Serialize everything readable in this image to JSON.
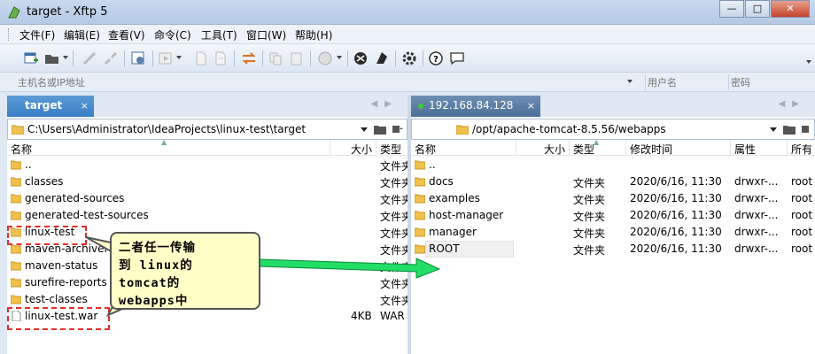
{
  "window": {
    "title": "target - Xftp 5",
    "minimize": "—",
    "maximize": "□",
    "close": "✕"
  },
  "menu": [
    "文件(F)",
    "编辑(E)",
    "查看(V)",
    "命令(C)",
    "工具(T)",
    "窗口(W)",
    "帮助(H)"
  ],
  "address": {
    "host_placeholder": "主机名或IP地址",
    "user_placeholder": "用户名",
    "pass_placeholder": "密码"
  },
  "left_pane": {
    "tab_label": "target",
    "tab_close": "×",
    "path": "C:\\Users\\Administrator\\IdeaProjects\\linux-test\\target",
    "columns": [
      "名称",
      "大小",
      "类型"
    ],
    "files": [
      {
        "name": "..",
        "size": "",
        "type": "文件夹",
        "kind": "folder"
      },
      {
        "name": "classes",
        "size": "",
        "type": "文件夹",
        "kind": "folder"
      },
      {
        "name": "generated-sources",
        "size": "",
        "type": "文件夹",
        "kind": "folder"
      },
      {
        "name": "generated-test-sources",
        "size": "",
        "type": "文件夹",
        "kind": "folder"
      },
      {
        "name": "linux-test",
        "size": "",
        "type": "文件夹",
        "kind": "folder"
      },
      {
        "name": "maven-archiver",
        "size": "",
        "type": "文件夹",
        "kind": "folder"
      },
      {
        "name": "maven-status",
        "size": "",
        "type": "文件夹",
        "kind": "folder"
      },
      {
        "name": "surefire-reports",
        "size": "",
        "type": "文件夹",
        "kind": "folder"
      },
      {
        "name": "test-classes",
        "size": "",
        "type": "文件夹",
        "kind": "folder"
      },
      {
        "name": "linux-test.war",
        "size": "4KB",
        "type": "WAR",
        "kind": "file"
      }
    ]
  },
  "right_pane": {
    "tab_label": "192.168.84.128",
    "tab_close": "×",
    "path": "/opt/apache-tomcat-8.5.56/webapps",
    "columns": [
      "名称",
      "大小",
      "类型",
      "修改时间",
      "属性",
      "所有"
    ],
    "files": [
      {
        "name": "..",
        "size": "",
        "type": "",
        "modified": "",
        "attrs": "",
        "owner": "",
        "kind": "folder"
      },
      {
        "name": "docs",
        "size": "",
        "type": "文件夹",
        "modified": "2020/6/16, 11:30",
        "attrs": "drwxr-...",
        "owner": "root",
        "kind": "folder"
      },
      {
        "name": "examples",
        "size": "",
        "type": "文件夹",
        "modified": "2020/6/16, 11:30",
        "attrs": "drwxr-...",
        "owner": "root",
        "kind": "folder"
      },
      {
        "name": "host-manager",
        "size": "",
        "type": "文件夹",
        "modified": "2020/6/16, 11:30",
        "attrs": "drwxr-...",
        "owner": "root",
        "kind": "folder"
      },
      {
        "name": "manager",
        "size": "",
        "type": "文件夹",
        "modified": "2020/6/16, 11:30",
        "attrs": "drwxr-...",
        "owner": "root",
        "kind": "folder"
      },
      {
        "name": "ROOT",
        "size": "",
        "type": "文件夹",
        "modified": "2020/6/16, 11:30",
        "attrs": "drwxr-...",
        "owner": "root",
        "kind": "folder"
      }
    ]
  },
  "annotation": {
    "lines": [
      "二者任一传输",
      "到 linux的",
      "tomcat的",
      "webapps中"
    ],
    "box_color": "#e0302a",
    "arrow_color": "#22dd66"
  },
  "toolbar_icons": [
    "new-session-icon",
    "open-folder-icon",
    "connect-icon",
    "disconnect-icon",
    "properties-icon",
    "play-icon",
    "file-icon",
    "file-copy-icon",
    "transfer-icon",
    "copy-icon",
    "paste-icon",
    "globe-icon",
    "xshell-icon",
    "xftp-icon",
    "gear-icon",
    "help-icon",
    "chat-icon"
  ]
}
